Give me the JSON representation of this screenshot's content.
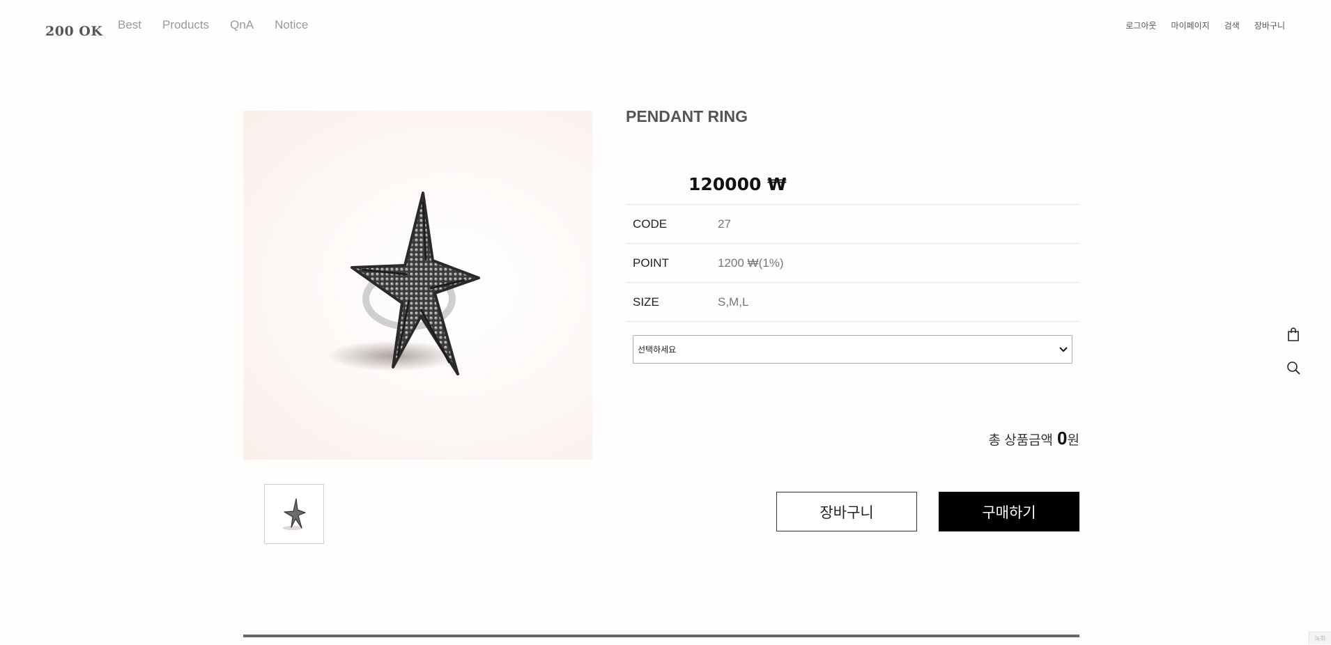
{
  "header": {
    "logo": "200 OK",
    "nav": [
      "Best",
      "Products",
      "QnA",
      "Notice"
    ],
    "util": [
      "로그아웃",
      "마이페이지",
      "검색",
      "장바구니"
    ]
  },
  "product": {
    "name": "PENDANT RING",
    "price": "120000 ₩",
    "info": [
      {
        "label": "CODE",
        "value": "27"
      },
      {
        "label": "POINT",
        "value": "1200 ₩(1%)"
      },
      {
        "label": "SIZE",
        "value": "S,M,L"
      }
    ],
    "option_select": {
      "selected": "선택하세요"
    },
    "total": {
      "label": "총 상품금액",
      "amount": "0",
      "unit": "원"
    }
  },
  "buttons": {
    "cart": "장바구니",
    "buy": "구매하기"
  },
  "side_icons": [
    "shopping-bag-icon",
    "search-icon"
  ],
  "corner_badge": "녹화"
}
